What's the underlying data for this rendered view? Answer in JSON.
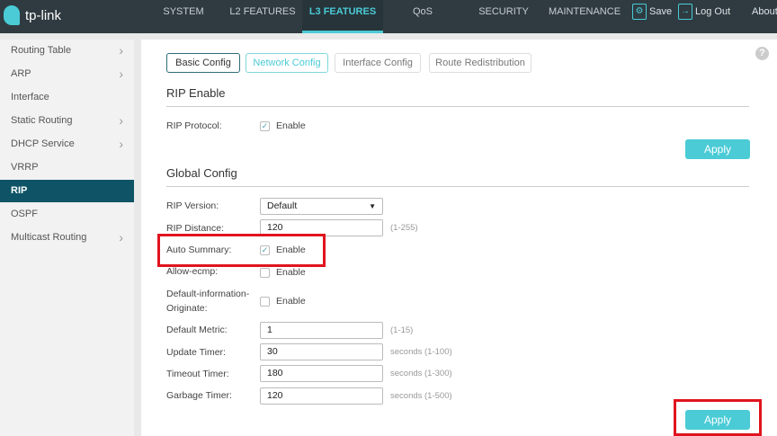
{
  "header": {
    "logo": "tp-link",
    "nav": [
      "SYSTEM",
      "L2 FEATURES",
      "L3 FEATURES",
      "QoS",
      "SECURITY",
      "MAINTENANCE"
    ],
    "active": "L3 FEATURES",
    "save": "Save",
    "logout": "Log Out",
    "about": "About"
  },
  "sidebar": {
    "items": [
      {
        "label": "Routing Table",
        "chevron": true
      },
      {
        "label": "ARP",
        "chevron": true
      },
      {
        "label": "Interface",
        "chevron": false
      },
      {
        "label": "Static Routing",
        "chevron": true
      },
      {
        "label": "DHCP Service",
        "chevron": true
      },
      {
        "label": "VRRP",
        "chevron": false
      },
      {
        "label": "RIP",
        "chevron": false,
        "selected": true
      },
      {
        "label": "OSPF",
        "chevron": false
      },
      {
        "label": "Multicast Routing",
        "chevron": true
      }
    ]
  },
  "tabs": [
    "Basic Config",
    "Network Config",
    "Interface Config",
    "Route Redistribution"
  ],
  "rip_enable": {
    "title": "RIP Enable",
    "protocol_label": "RIP Protocol:",
    "protocol_enabled": true,
    "enable": "Enable",
    "apply": "Apply"
  },
  "global": {
    "title": "Global Config",
    "version_label": "RIP Version:",
    "version": "Default",
    "distance_label": "RIP Distance:",
    "distance": "120",
    "distance_hint": "(1-255)",
    "auto_summary_label": "Auto Summary:",
    "auto_summary": true,
    "ecmp_label": "Allow-ecmp:",
    "ecmp": false,
    "dio_label_1": "Default-information-",
    "dio_label_2": "Originate:",
    "dio": false,
    "enable": "Enable",
    "metric_label": "Default Metric:",
    "metric": "1",
    "metric_hint": "(1-15)",
    "update_label": "Update Timer:",
    "update": "30",
    "update_hint": "seconds (1-100)",
    "timeout_label": "Timeout Timer:",
    "timeout": "180",
    "timeout_hint": "seconds (1-300)",
    "garbage_label": "Garbage Timer:",
    "garbage": "120",
    "garbage_hint": "seconds (1-500)",
    "apply": "Apply"
  },
  "colors": {
    "accent": "#4acbd6",
    "header": "#2f3b41",
    "selected": "#0e5466",
    "highlight": "#e0141e"
  }
}
